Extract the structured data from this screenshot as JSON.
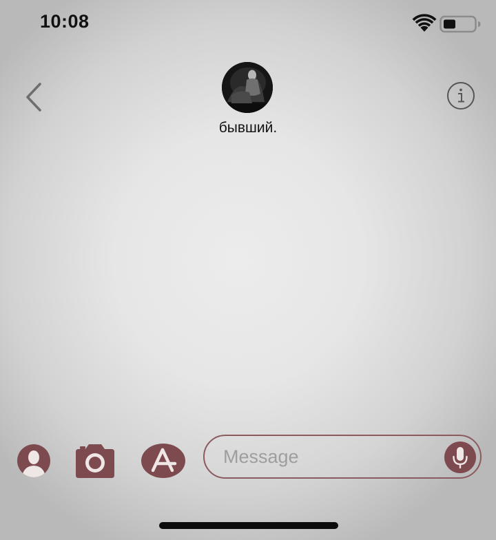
{
  "status_bar": {
    "time": "10:08",
    "wifi_icon": "wifi-icon",
    "battery_icon": "battery-icon"
  },
  "header": {
    "back_icon": "chevron-left-icon",
    "contact_name": "бывший.",
    "avatar": "contact-avatar-photo",
    "info_icon": "info-icon"
  },
  "composer": {
    "placeholder": "Message",
    "contact_icon": "person-icon",
    "camera_icon": "camera-icon",
    "apps_icon": "app-store-icon",
    "mic_icon": "microphone-icon"
  },
  "colors": {
    "accent": "#7d4a4f",
    "text": "#111111",
    "placeholder": "#9e9e9e"
  }
}
